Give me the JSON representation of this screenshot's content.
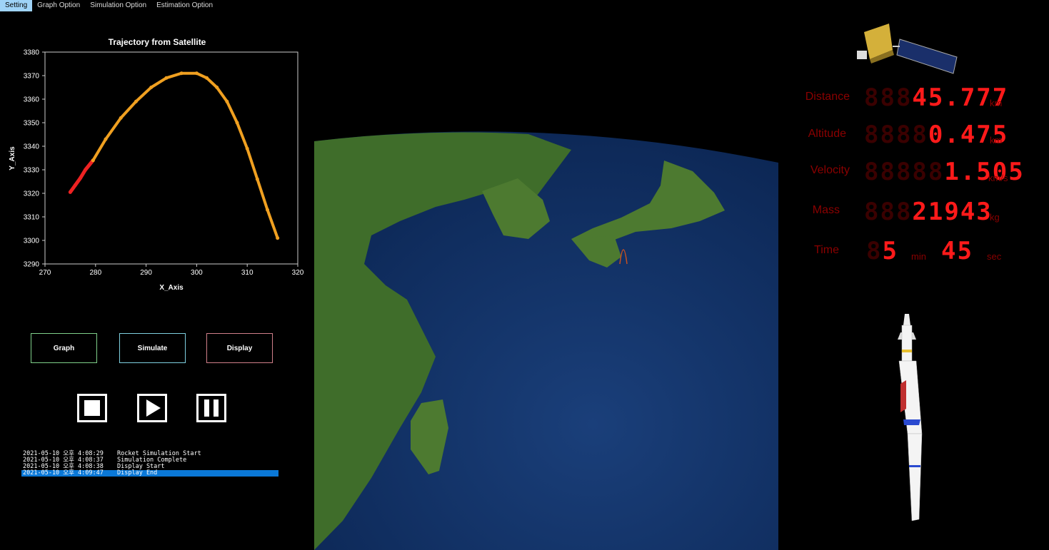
{
  "menu": [
    "Setting",
    "Graph Option",
    "Simulation Option",
    "Estimation Option"
  ],
  "chart_data": {
    "type": "scatter",
    "title": "Trajectory from Satellite",
    "xlabel": "X_Axis",
    "ylabel": "Y_Axis",
    "xlim": [
      270,
      320
    ],
    "ylim": [
      3290,
      3380
    ],
    "xticks": [
      270,
      280,
      290,
      300,
      310,
      320
    ],
    "yticks": [
      3290,
      3300,
      3310,
      3320,
      3330,
      3340,
      3350,
      3360,
      3370,
      3380
    ],
    "grid": false,
    "series": [
      {
        "color": "#ee2222",
        "x": [
          275,
          276,
          277,
          278,
          279.5
        ],
        "y": [
          3320.5,
          3323.5,
          3326.5,
          3330,
          3334
        ]
      },
      {
        "color": "#f0a020",
        "x": [
          279.5,
          282,
          285,
          288,
          291,
          294,
          297,
          300,
          302,
          304,
          306,
          308,
          310,
          312,
          314,
          316
        ],
        "y": [
          3334,
          3343,
          3352,
          3359,
          3365,
          3369,
          3371,
          3371,
          3369,
          3365,
          3359,
          3350,
          3339,
          3326,
          3313,
          3301
        ]
      }
    ]
  },
  "buttons": {
    "graph": "Graph",
    "simulate": "Simulate",
    "display": "Display"
  },
  "log": [
    {
      "ts": "2021-05-10 오후 4:08:29",
      "msg": "Rocket Simulation Start"
    },
    {
      "ts": "2021-05-10 오후 4:08:37",
      "msg": "Simulation Complete"
    },
    {
      "ts": "2021-05-10 오후 4:08:38",
      "msg": "Display Start"
    },
    {
      "ts": "2021-05-10 오후 4:09:47",
      "msg": "Display End"
    }
  ],
  "readouts": {
    "distance": {
      "label": "Distance",
      "dim": "888",
      "value": "45.777",
      "unit": "km"
    },
    "altitude": {
      "label": "Altitude",
      "dim": "8888",
      "value": "0.475",
      "unit": "km"
    },
    "velocity": {
      "label": "Velocity",
      "dim": "88888",
      "value": "1.505",
      "unit": "km/s"
    },
    "mass": {
      "label": "Mass",
      "dim": "888",
      "value": "21943",
      "unit": "kg"
    },
    "time": {
      "label": "Time",
      "min_dim": "8",
      "min": "5",
      "min_unit": "min",
      "sec": "45",
      "sec_unit": "sec"
    }
  },
  "colors": {
    "accent": "#0a78d7",
    "led": "#ff1a1a",
    "led_dim": "#3a0000",
    "trajectory_start": "#ee2222",
    "trajectory": "#f0a020"
  }
}
